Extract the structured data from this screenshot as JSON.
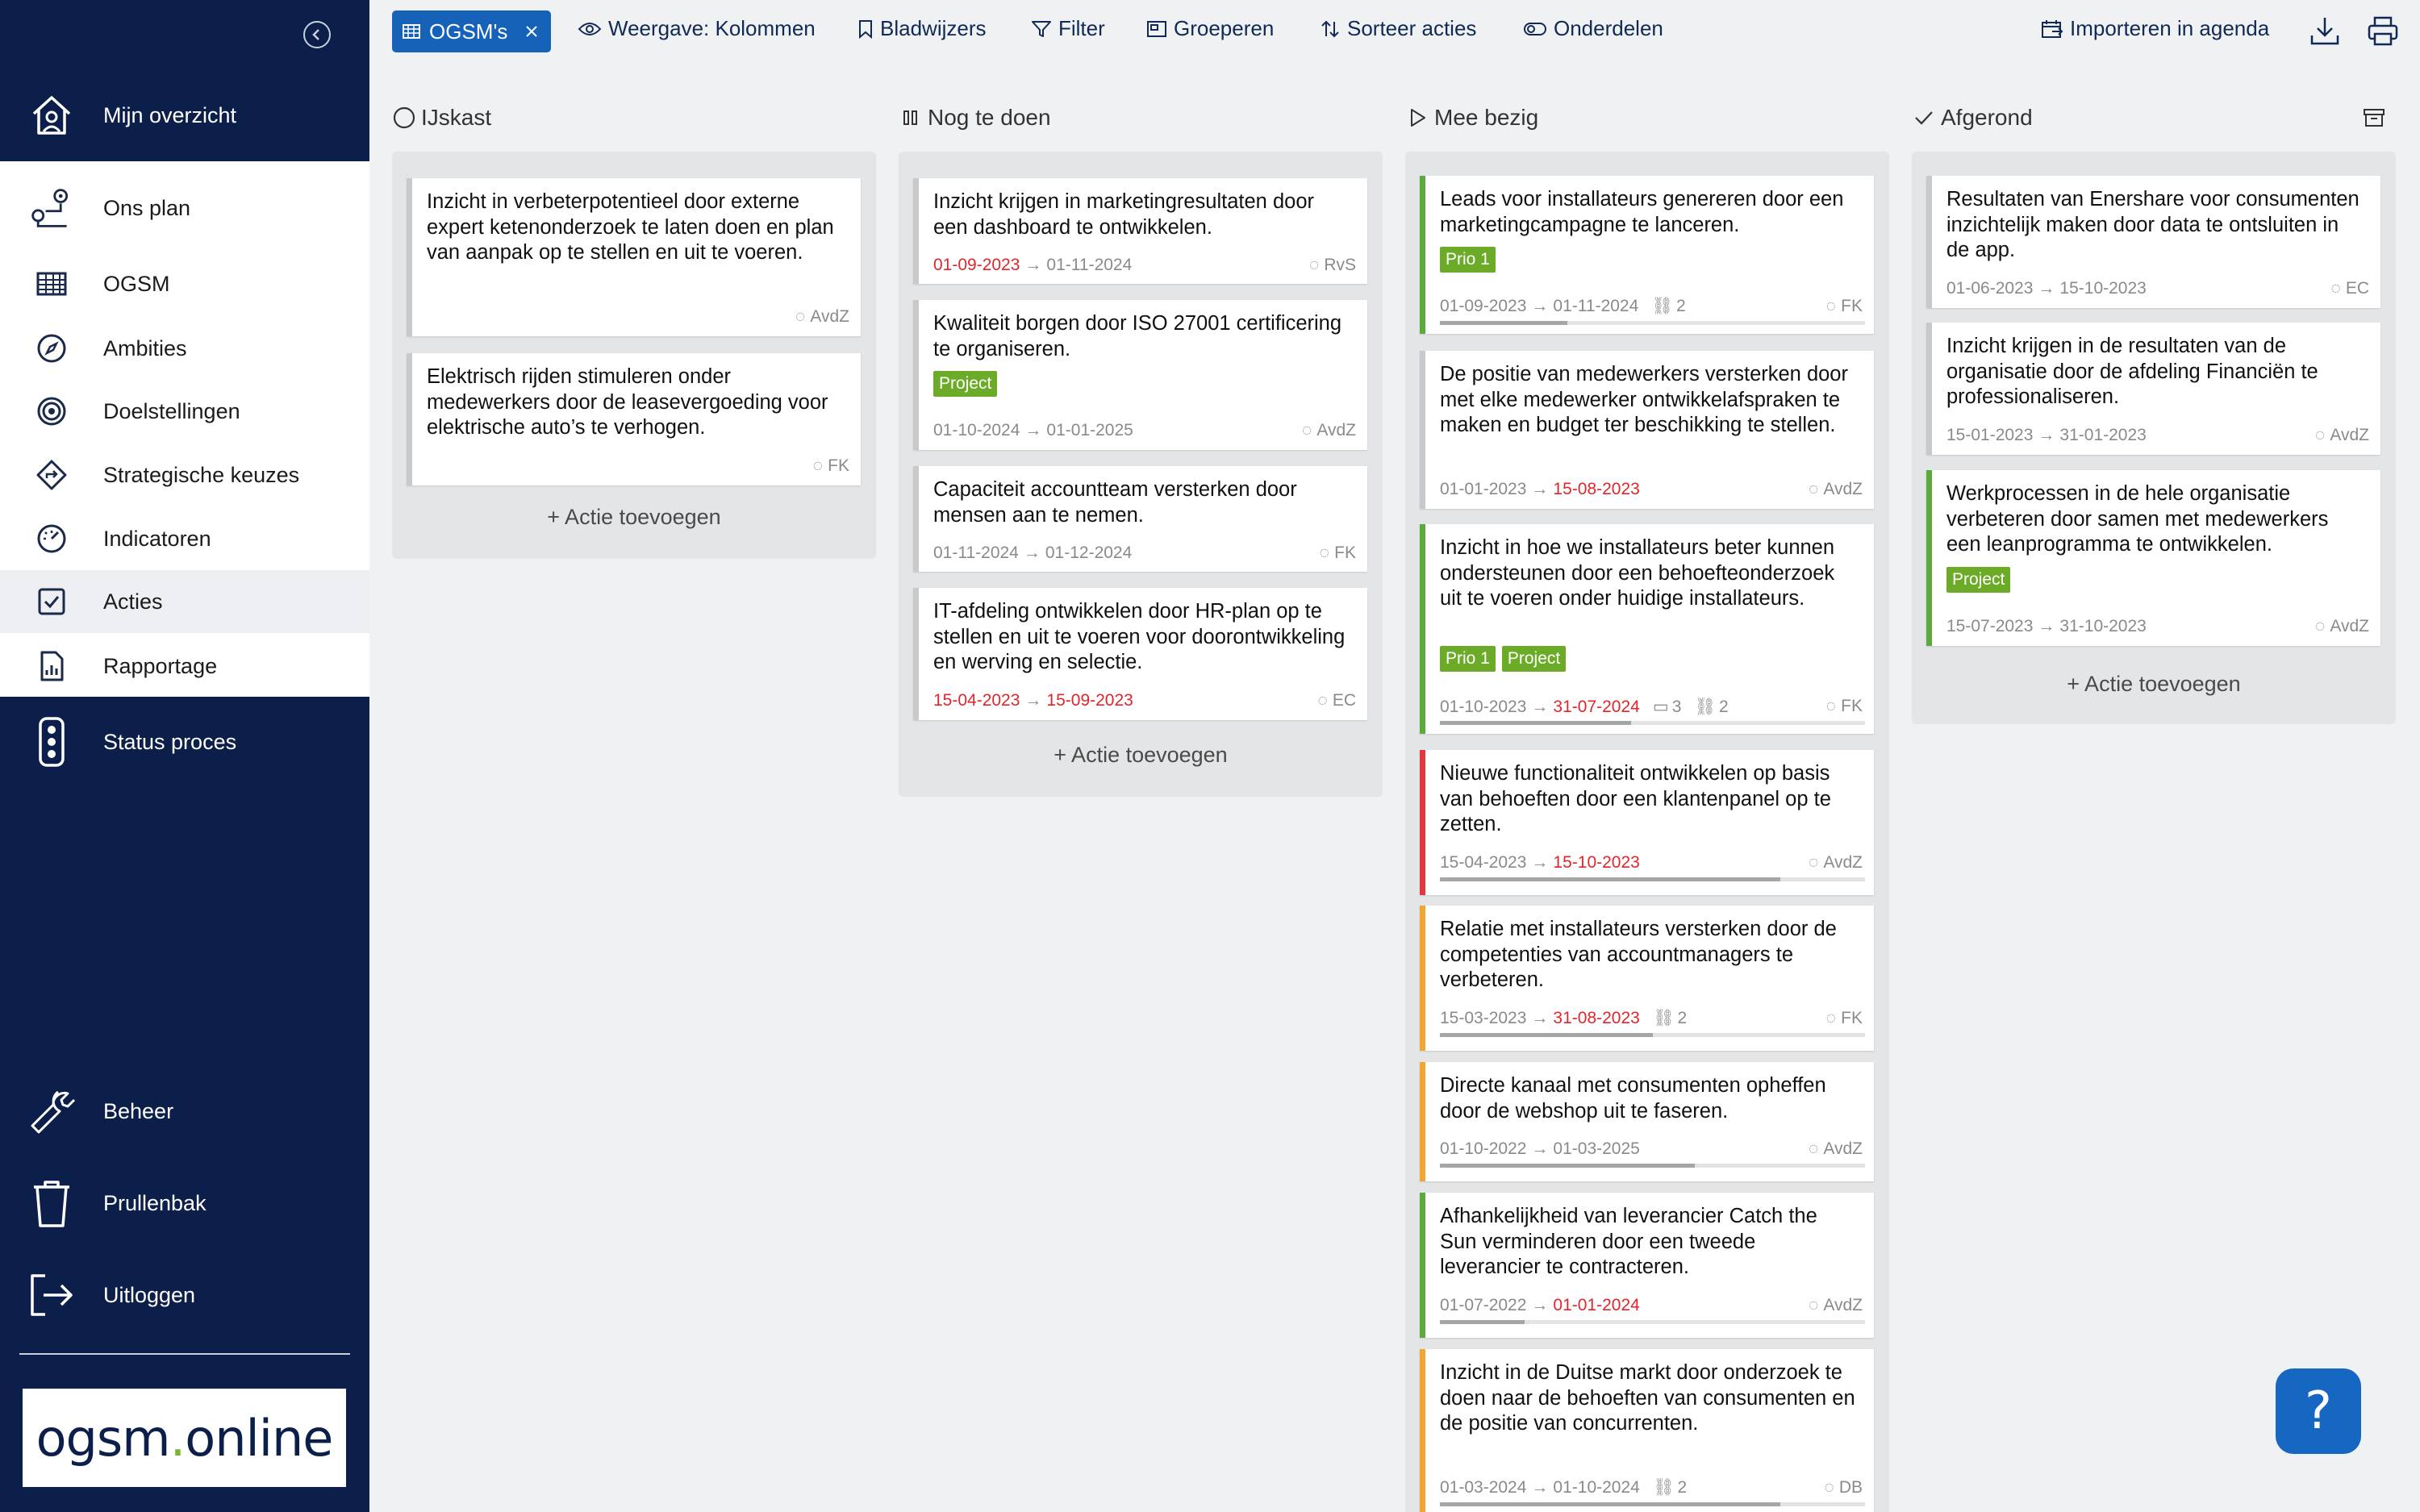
{
  "sidebar": {
    "top_item": {
      "label": "Mijn overzicht",
      "icon": "home-icon"
    },
    "items": [
      {
        "label": "Ons plan",
        "icon": "route-icon"
      },
      {
        "label": "OGSM",
        "icon": "table-icon"
      },
      {
        "label": "Ambities",
        "icon": "compass-icon"
      },
      {
        "label": "Doelstellingen",
        "icon": "target-icon"
      },
      {
        "label": "Strategische keuzes",
        "icon": "signpost-icon"
      },
      {
        "label": "Indicatoren",
        "icon": "gauge-icon"
      },
      {
        "label": "Acties",
        "icon": "checkbox-icon"
      },
      {
        "label": "Rapportage",
        "icon": "report-icon"
      }
    ],
    "status": {
      "label": "Status proces",
      "icon": "traffic-light-icon"
    },
    "bottom": [
      {
        "label": "Beheer",
        "icon": "wrench-icon"
      },
      {
        "label": "Prullenbak",
        "icon": "trash-icon"
      },
      {
        "label": "Uitloggen",
        "icon": "logout-icon"
      }
    ],
    "logo": {
      "part1": "ogsm",
      "part2": "online"
    }
  },
  "toolbar": {
    "chip": "OGSM's",
    "view": "Weergave: Kolommen",
    "bookmarks": "Bladwijzers",
    "filter": "Filter",
    "group": "Groeperen",
    "sort": "Sorteer acties",
    "parts": "Onderdelen",
    "import": "Importeren in agenda"
  },
  "columns": [
    {
      "name": "IJskast",
      "add": "+ Actie toevoegen",
      "cards": [
        {
          "title": "Inzicht in verbeterpotentieel door externe expert ketenonderzoek te laten doen en plan van aanpak op te stellen en uit te voeren.",
          "owner": "AvdZ"
        },
        {
          "title": "Elektrisch rijden stimuleren onder medewerkers door de leasevergoeding voor elektrische auto’s te verhogen.",
          "owner": "FK"
        }
      ]
    },
    {
      "name": "Nog te doen",
      "add": "+ Actie toevoegen",
      "cards": [
        {
          "title": "Inzicht krijgen in marketingresultaten door een dashboard te ontwikkelen.",
          "start": "01-09-2023",
          "end": "01-11-2024",
          "owner": "RvS"
        },
        {
          "title": "Kwaliteit borgen door ISO 27001 certificering te organiseren.",
          "tags": [
            "Project"
          ],
          "start": "01-10-2024",
          "end": "01-01-2025",
          "owner": "AvdZ"
        },
        {
          "title": "Capaciteit accountteam versterken door mensen aan te nemen.",
          "start": "01-11-2024",
          "end": "01-12-2024",
          "owner": "FK"
        },
        {
          "title": "IT-afdeling ontwikkelen door HR-plan op te stellen en uit te voeren voor doorontwikkeling en werving en selectie.",
          "start": "15-04-2023",
          "end": "15-09-2023",
          "owner": "EC"
        }
      ]
    },
    {
      "name": "Mee bezig",
      "add": "",
      "cards": [
        {
          "title": "Leads voor installateurs genereren door een marketingcampagne te lanceren.",
          "tags": [
            "Prio 1"
          ],
          "start": "01-09-2023",
          "end": "01-11-2024",
          "links": "2",
          "owner": "FK",
          "progress": 0.3
        },
        {
          "title": "De positie van medewerkers versterken door met elke medewerker ontwikkelafspraken te maken en budget ter beschikking te stellen.",
          "start": "01-01-2023",
          "end": "15-08-2023",
          "owner": "AvdZ"
        },
        {
          "title": "Inzicht in hoe we installateurs beter kunnen ondersteunen door een behoefteonderzoek uit te voeren onder huidige installateurs.",
          "tags": [
            "Prio 1",
            "Project"
          ],
          "start": "01-10-2023",
          "end": "31-07-2024",
          "comments": "3",
          "links": "2",
          "owner": "FK",
          "progress": 0.45
        },
        {
          "title": "Nieuwe functionaliteit ontwikkelen op basis van behoeften door een klantenpanel op te zetten.",
          "start": "15-04-2023",
          "end": "15-10-2023",
          "owner": "AvdZ",
          "progress": 0.8
        },
        {
          "title": "Relatie met installateurs versterken door de competenties van accountmanagers te verbeteren.",
          "start": "15-03-2023",
          "end": "31-08-2023",
          "links": "2",
          "owner": "FK",
          "progress": 0.5
        },
        {
          "title": "Directe kanaal met consumenten opheffen door de webshop uit te faseren.",
          "start": "01-10-2022",
          "end": "01-03-2025",
          "owner": "AvdZ",
          "progress": 0.6
        },
        {
          "title": "Afhankelijkheid van leverancier Catch the Sun verminderen door een tweede leverancier te contracteren.",
          "start": "01-07-2022",
          "end": "01-01-2024",
          "owner": "AvdZ",
          "progress": 0.2
        },
        {
          "title": "Inzicht in de Duitse markt door onderzoek te doen naar de behoeften van consumenten en de positie van concurrenten.",
          "start": "01-03-2024",
          "end": "01-10-2024",
          "links": "2",
          "owner": "DB",
          "progress": 0.8
        }
      ]
    },
    {
      "name": "Afgerond",
      "add": "+ Actie toevoegen",
      "cards": [
        {
          "title": "Resultaten van Enershare voor consumenten inzichtelijk maken door data te ontsluiten in de app.",
          "start": "01-06-2023",
          "end": "15-10-2023",
          "owner": "EC"
        },
        {
          "title": "Inzicht krijgen in de resultaten van de organisatie door de afdeling Financiën te professionaliseren.",
          "start": "15-01-2023",
          "end": "31-01-2023",
          "owner": "AvdZ"
        },
        {
          "title": "Werkprocessen in de hele organisatie verbeteren door samen met medewerkers een leanprogramma te ontwikkelen.",
          "tags": [
            "Project"
          ],
          "start": "15-07-2023",
          "end": "31-10-2023",
          "owner": "AvdZ"
        }
      ]
    }
  ],
  "help": "?",
  "colors": {
    "sidebar": "#0c1f4a",
    "accent": "#1562b8",
    "tag": "#6cab28",
    "late": "#e0262c"
  }
}
